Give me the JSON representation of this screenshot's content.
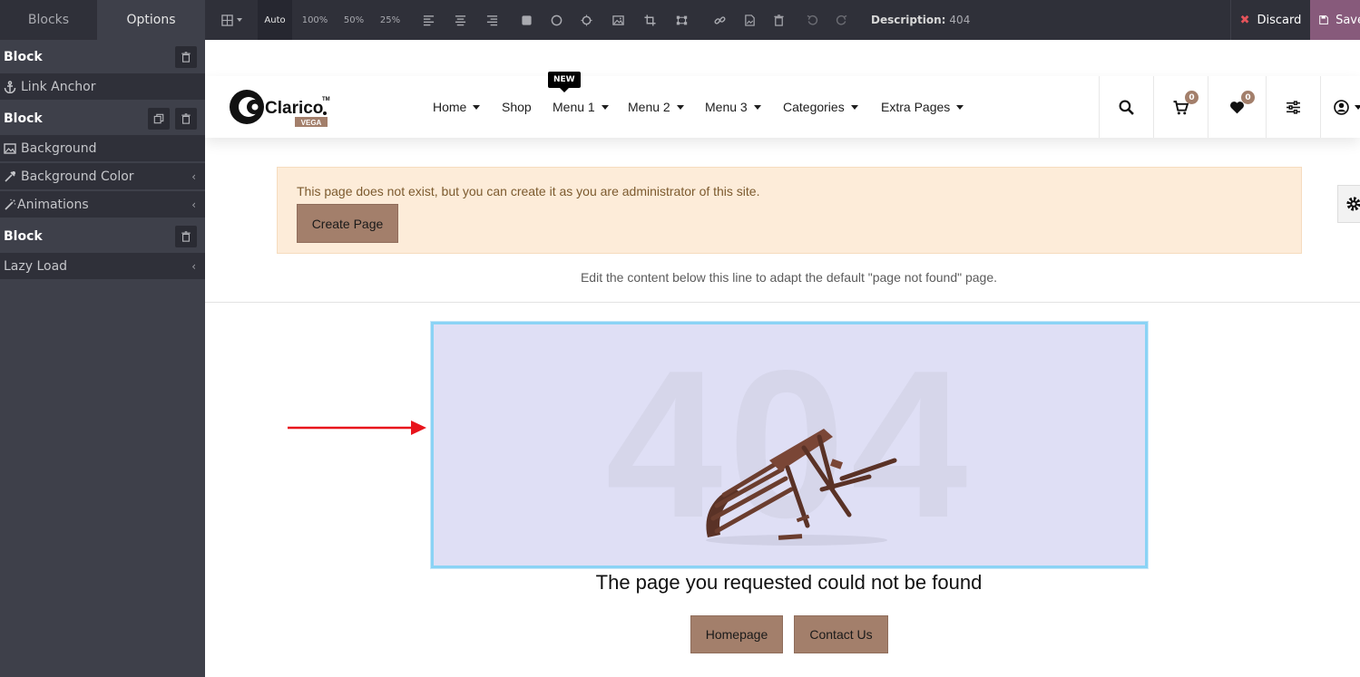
{
  "toolbar": {
    "tabs": [
      "Blocks",
      "Options"
    ],
    "size_auto": "Auto",
    "size_100": "100%",
    "size_50": "50%",
    "size_25": "25%",
    "description_label": "Description:",
    "description_value": "404",
    "discard_label": "Discard",
    "save_label": "Save"
  },
  "sidepanel": {
    "block1_title": "Block",
    "link_anchor": "Link Anchor",
    "block2_title": "Block",
    "background": "Background",
    "background_color": "Background Color",
    "animations": "Animations",
    "block3_title": "Block",
    "lazy_load": "Lazy Load"
  },
  "navbar": {
    "logo_text": "Clarico",
    "logo_sub": "VEGA",
    "logo_tm": "TM",
    "new_badge": "NEW",
    "menu": [
      "Home",
      "Shop",
      "Menu 1",
      "Menu 2",
      "Menu 3",
      "Categories",
      "Extra Pages"
    ],
    "cart_count": "0",
    "wishlist_count": "0"
  },
  "alert": {
    "text": "This page does not exist, but you can create it as you are administrator of this site.",
    "create_button": "Create Page"
  },
  "edit_note": "Edit the content below this line to adapt the default \"page not found\" page.",
  "error_image": {
    "text": "404"
  },
  "not_found_text": "The page you requested could not be found",
  "buttons": {
    "homepage": "Homepage",
    "contact": "Contact Us"
  },
  "colors": {
    "toolbar_bg": "#2f3039",
    "panel_bg": "#3e404a",
    "save_bg": "#875a7b",
    "brand_brown": "#a37f6b",
    "alert_bg": "#fdecd9",
    "selection_border": "#8ad3f5"
  }
}
